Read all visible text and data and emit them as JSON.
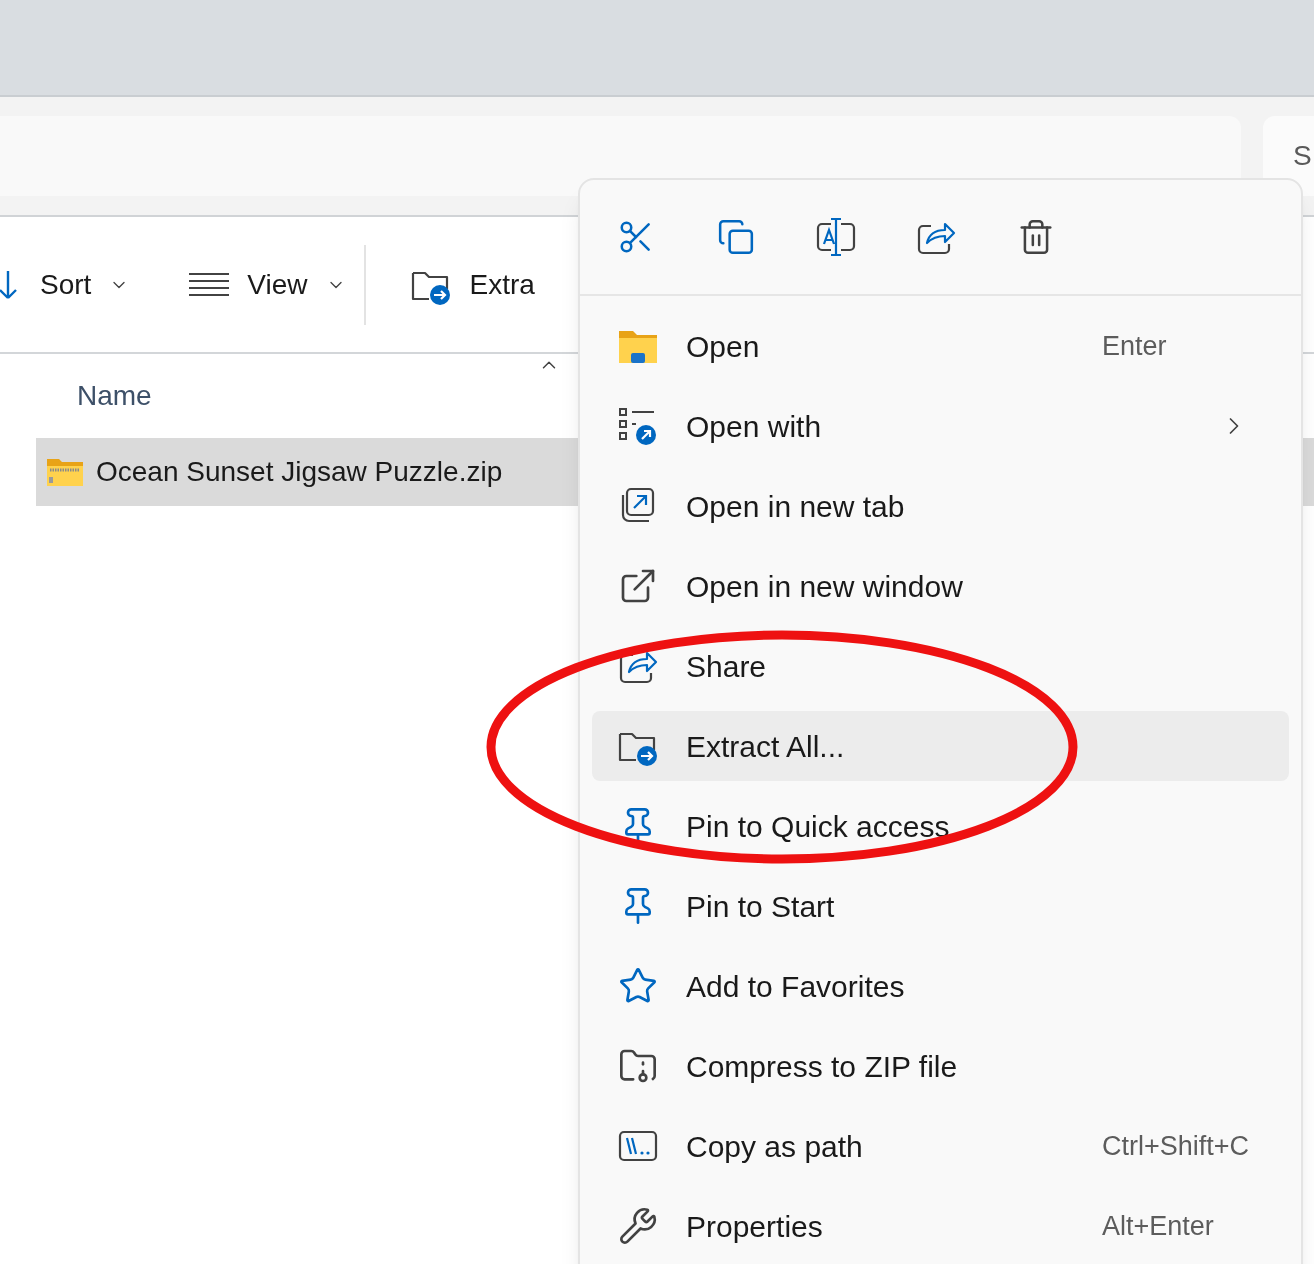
{
  "search": {
    "placeholder": "S"
  },
  "toolbar": [
    {
      "label": "Sort",
      "dropdown": true
    },
    {
      "label": "View",
      "dropdown": true
    },
    {
      "label": "Extra",
      "dropdown": false
    }
  ],
  "file_list": {
    "columns": [
      {
        "label": "Name",
        "sorted": true
      }
    ],
    "rows": [
      {
        "name": "Ocean Sunset Jigsaw Puzzle.zip",
        "selected": true
      }
    ]
  },
  "context_menu": {
    "items": [
      {
        "label": "Open",
        "shortcut": "Enter",
        "submenu": false,
        "selected": false
      },
      {
        "label": "Open with",
        "submenu": true,
        "selected": false
      },
      {
        "label": "Open in new tab",
        "submenu": false,
        "selected": false
      },
      {
        "label": "Open in new window",
        "submenu": false,
        "selected": false
      },
      {
        "label": "Share",
        "submenu": false,
        "selected": false
      },
      {
        "label": "Extract All...",
        "submenu": false,
        "selected": true
      },
      {
        "label": "Pin to Quick access",
        "submenu": false,
        "selected": false
      },
      {
        "label": "Pin to Start",
        "submenu": false,
        "selected": false
      },
      {
        "label": "Add to Favorites",
        "submenu": false,
        "selected": false
      },
      {
        "label": "Compress to ZIP file",
        "submenu": false,
        "selected": false
      },
      {
        "label": "Copy as path",
        "shortcut": "Ctrl+Shift+C",
        "submenu": false,
        "selected": false
      },
      {
        "label": "Properties",
        "shortcut": "Alt+Enter",
        "submenu": false,
        "selected": false
      }
    ]
  }
}
